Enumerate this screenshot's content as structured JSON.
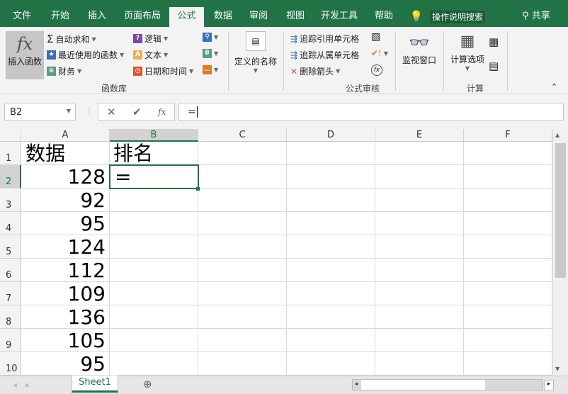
{
  "tabs": [
    "文件",
    "开始",
    "插入",
    "页面布局",
    "公式",
    "数据",
    "审阅",
    "视图",
    "开发工具",
    "帮助"
  ],
  "active_tab": "公式",
  "search": "操作说明搜索",
  "share": "共享",
  "ribbon": {
    "insert_function": "插入函数",
    "autosum": "自动求和",
    "recent": "最近使用的函数",
    "financial": "财务",
    "logical": "逻辑",
    "text": "文本",
    "datetime": "日期和时间",
    "define_name": "定义的名称",
    "trace_precedents": "追踪引用单元格",
    "trace_dependents": "追踪从属单元格",
    "remove_arrows": "删除箭头",
    "watch_window": "监视窗口",
    "calc_options": "计算选项",
    "group_library": "函数库",
    "group_auditing": "公式审核",
    "group_calc": "计算"
  },
  "name_box": "B2",
  "formula": "=",
  "columns": [
    "A",
    "B",
    "C",
    "D",
    "E",
    "F"
  ],
  "rows": [
    "1",
    "2",
    "3",
    "4",
    "5",
    "6",
    "7",
    "8",
    "9",
    "10"
  ],
  "cells": {
    "A1": "数据",
    "B1": "排名",
    "B2": "=",
    "A": [
      "128",
      "92",
      "95",
      "124",
      "112",
      "109",
      "136",
      "105",
      "95"
    ]
  },
  "sheet": "Sheet1",
  "colors": {
    "brand": "#217346"
  }
}
